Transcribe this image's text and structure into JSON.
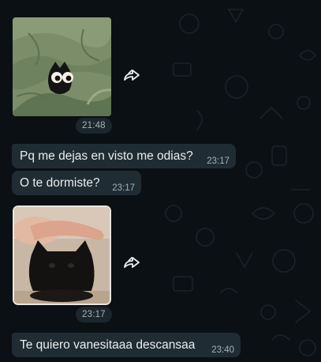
{
  "messages": {
    "sticker_owl": {
      "time": "21:48"
    },
    "text_1": {
      "text": "Pq me dejas en visto me odias?",
      "time": "23:17"
    },
    "text_2": {
      "text": "O te dormiste?",
      "time": "23:17"
    },
    "photo_cat": {
      "time": "23:17"
    },
    "text_3": {
      "text": "Te quiero vanesitaaa descansaa",
      "time": "23:40"
    }
  },
  "icons": {
    "forward": "forward-arrow-icon"
  },
  "colors": {
    "chat_background": "#0b1014",
    "incoming_bubble": "#1f2c33",
    "message_text": "#e9edef",
    "timestamp_text": "#a5b1b8"
  }
}
